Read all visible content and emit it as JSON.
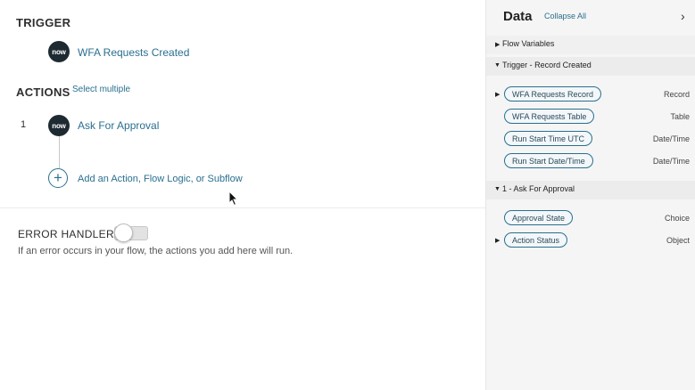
{
  "trigger": {
    "heading": "TRIGGER",
    "badge": "now",
    "label": "WFA Requests Created"
  },
  "actions": {
    "heading": "ACTIONS",
    "select_multiple": "Select multiple",
    "steps": [
      {
        "number": "1",
        "badge": "now",
        "label": "Ask For Approval"
      }
    ],
    "add_label": "Add an Action, Flow Logic, or Subflow",
    "add_icon": "plus-icon"
  },
  "error_handler": {
    "heading": "ERROR HANDLER",
    "toggle_on": false,
    "helper": "If an error occurs in your flow, the actions you add here will run."
  },
  "data_panel": {
    "title": "Data",
    "collapse_all": "Collapse All",
    "close_icon": "chevron-right-icon",
    "groups": [
      {
        "label": "Flow Variables",
        "expanded": false
      },
      {
        "label": "Trigger - Record Created",
        "expanded": true,
        "items": [
          {
            "pill": "WFA Requests Record",
            "type": "Record",
            "expandable": true
          },
          {
            "pill": "WFA Requests Table",
            "type": "Table",
            "expandable": false
          },
          {
            "pill": "Run Start Time UTC",
            "type": "Date/Time",
            "expandable": false
          },
          {
            "pill": "Run Start Date/Time",
            "type": "Date/Time",
            "expandable": false
          }
        ]
      },
      {
        "label": "1 - Ask For Approval",
        "expanded": true,
        "items": [
          {
            "pill": "Approval State",
            "type": "Choice",
            "expandable": false
          },
          {
            "pill": "Action Status",
            "type": "Object",
            "expandable": true
          }
        ]
      }
    ]
  },
  "colors": {
    "accent": "#2a6f8f",
    "badge": "#1e2a32",
    "panel_bg": "#f5f5f5"
  }
}
